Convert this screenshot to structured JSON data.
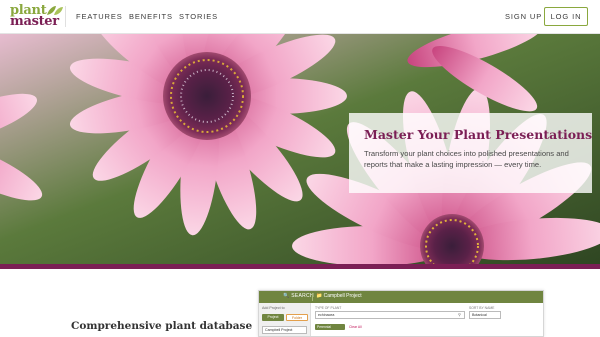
{
  "brand": {
    "name_top": "plant",
    "name_bottom": "master",
    "colors": {
      "green": "#8aa83e",
      "plum": "#7b1f55",
      "app_green": "#708540"
    }
  },
  "nav": {
    "items": [
      {
        "label": "FEATURES"
      },
      {
        "label": "BENEFITS"
      },
      {
        "label": "STORIES"
      }
    ],
    "signup_label": "SIGN UP",
    "login_label": "LOG IN"
  },
  "hero": {
    "title": "Master Your Plant Presentations",
    "text": "Transform your plant choices into polished presentations and reports that make a lasting impression — every time.",
    "image": "pink-african-daisy-flowers"
  },
  "feature": {
    "heading": "Comprehensive plant database"
  },
  "app_preview": {
    "search_label": "SEARCH",
    "project_tab": "Campbell Project",
    "sidebar_label": "Add Project to",
    "project_button": "Project",
    "folder_button": "Folder",
    "project_select": "Campbell Project",
    "type_label": "TYPE OF PLANT",
    "search_value": "echinacea",
    "sort_label": "SORT BY NAME",
    "sort_value": "Botanical",
    "filter_tag": "Perennial",
    "clear_label": "Clear All"
  }
}
